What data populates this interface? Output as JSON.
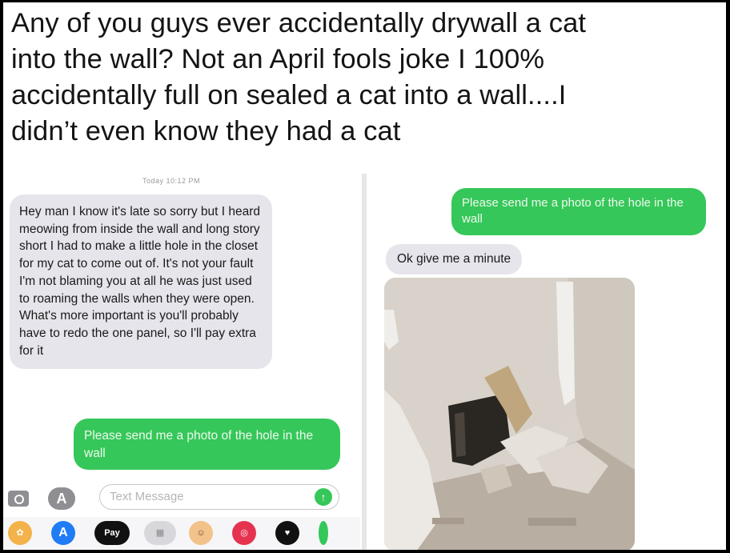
{
  "caption": {
    "line1": "Any of you guys ever accidentally drywall a cat",
    "line2": "into the wall? Not an April fools joke I 100%",
    "line3": "accidentally full on sealed a cat into a wall....I",
    "line4": "didn’t even know they had a cat"
  },
  "left_screenshot": {
    "timestamp": "Today 10:12 PM",
    "incoming_message": "Hey man I know it's late so sorry but I heard meowing from inside the wall and long story short I had to make a little hole in the closet for my cat to come out of. It's not your fault I'm not blaming you at all he was just used to roaming the walls when they were open. What's more important is you'll probably have to redo the one panel, so I'll pay extra for it",
    "outgoing_message": "Please send me a photo of the hole in the wall",
    "input_placeholder": "Text Message",
    "apps": {
      "apple_pay_label": "Pay"
    }
  },
  "right_screenshot": {
    "outgoing_message": "Please send me a photo of the hole in the wall",
    "incoming_message": "Ok give me a minute"
  },
  "colors": {
    "incoming_bubble": "#e6e5eb",
    "outgoing_bubble": "#35c759"
  },
  "icons": [
    "camera-icon",
    "app-store-icon",
    "send-arrow-icon",
    "photos-app-icon",
    "apple-pay-icon",
    "memoji-icon",
    "search-images-icon",
    "heart-app-icon"
  ]
}
